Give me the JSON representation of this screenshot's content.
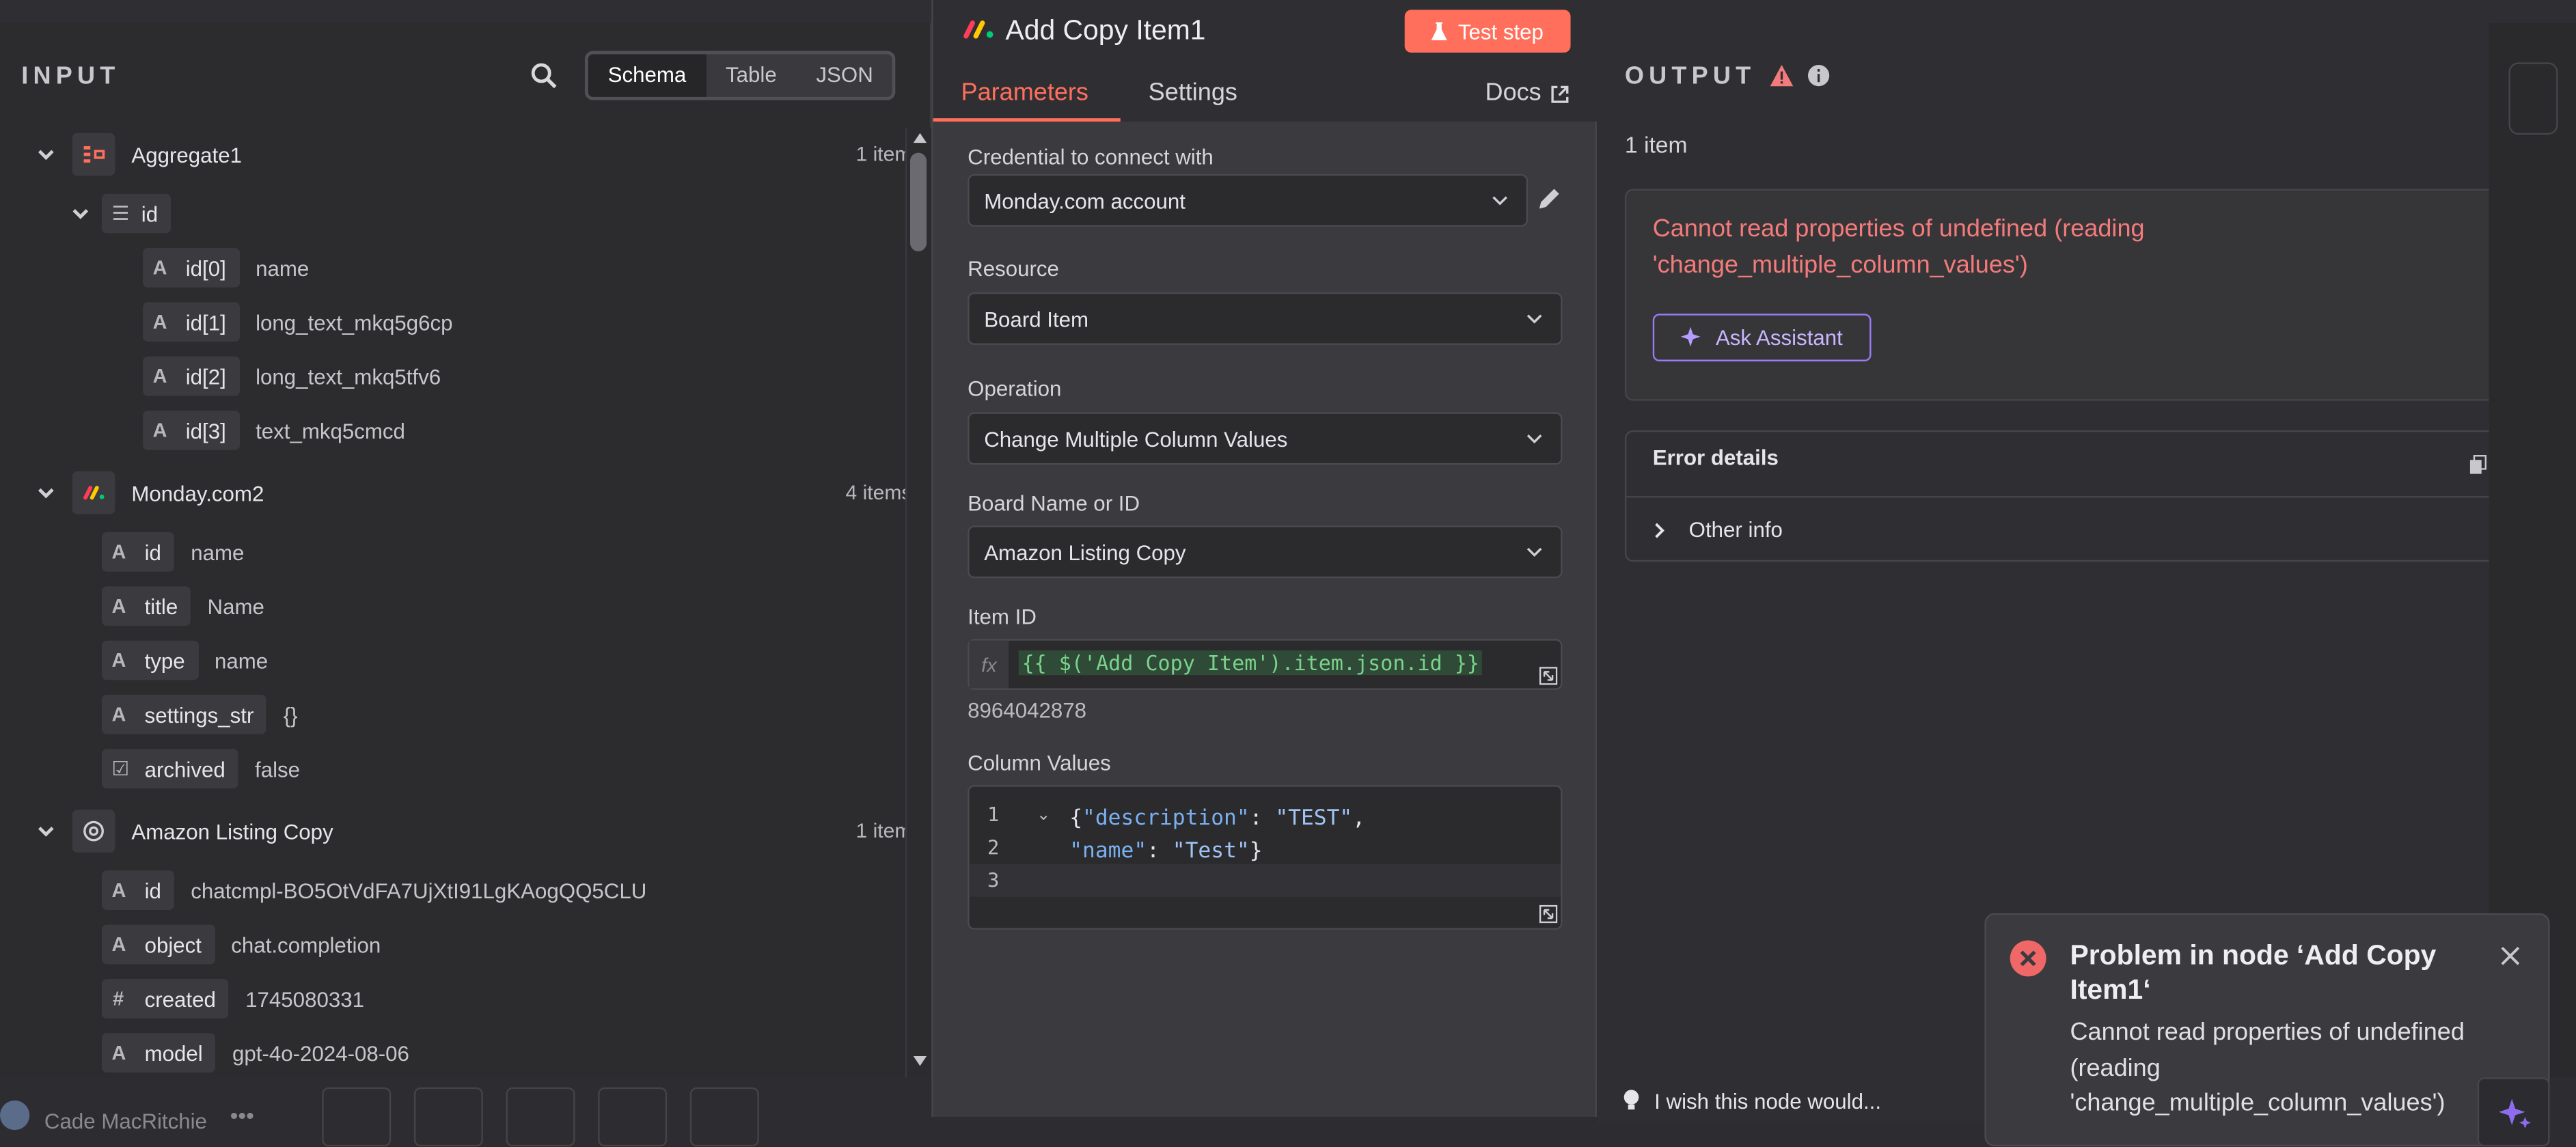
{
  "input": {
    "title": "INPUT",
    "views": [
      "Schema",
      "Table",
      "JSON"
    ],
    "nodes": [
      {
        "name": "Aggregate1",
        "count": "1 item"
      },
      {
        "name": "Monday.com2",
        "count": "4 items"
      },
      {
        "name": "Amazon Listing Copy",
        "count": "1 item"
      }
    ],
    "aggregate_group": "id",
    "aggregate_fields": [
      {
        "key": "id[0]",
        "value": "name"
      },
      {
        "key": "id[1]",
        "value": "long_text_mkq5g6cp"
      },
      {
        "key": "id[2]",
        "value": "long_text_mkq5tfv6"
      },
      {
        "key": "id[3]",
        "value": "text_mkq5cmcd"
      }
    ],
    "monday_fields": [
      {
        "type": "A",
        "key": "id",
        "value": "name"
      },
      {
        "type": "A",
        "key": "title",
        "value": "Name"
      },
      {
        "type": "A",
        "key": "type",
        "value": "name"
      },
      {
        "type": "A",
        "key": "settings_str",
        "value": "{}"
      },
      {
        "type": "☑",
        "key": "archived",
        "value": "false"
      }
    ],
    "amazon_fields": [
      {
        "type": "A",
        "key": "id",
        "value": "chatcmpl-BO5OtVdFA7UjXtI91LgKAogQQ5CLU"
      },
      {
        "type": "A",
        "key": "object",
        "value": "chat.completion"
      },
      {
        "type": "#",
        "key": "created",
        "value": "1745080331"
      },
      {
        "type": "A",
        "key": "model",
        "value": "gpt-4o-2024-08-06"
      }
    ]
  },
  "params": {
    "title": "Add Copy Item1",
    "test_step": "Test step",
    "tabs": [
      "Parameters",
      "Settings"
    ],
    "docs": "Docs",
    "credential_label": "Credential to connect with",
    "credential_value": "Monday.com account",
    "resource_label": "Resource",
    "resource_value": "Board Item",
    "operation_label": "Operation",
    "operation_value": "Change Multiple Column Values",
    "board_label": "Board Name or ID",
    "board_value": "Amazon Listing Copy",
    "item_id_label": "Item ID",
    "item_id_expr": "{{ $('Add Copy Item').item.json.id }}",
    "item_id_result": "8964042878",
    "column_values_label": "Column Values",
    "code_lines": [
      "1",
      "2",
      "3"
    ]
  },
  "output": {
    "title": "OUTPUT",
    "items": "1 item",
    "error_message": "Cannot read properties of undefined (reading 'change_multiple_column_values')",
    "ask_assistant": "Ask Assistant",
    "error_details": "Error details",
    "other_info": "Other info"
  },
  "toast": {
    "title": "Problem in node ‘Add Copy Item1‘",
    "message": "Cannot read properties of undefined (reading 'change_multiple_column_values')"
  },
  "footer": {
    "user": "Cade MacRitchie",
    "feedback": "I wish this node would..."
  },
  "colors": {
    "accent": "#ff6f5c",
    "error": "#f47b7b",
    "assistant": "#9b7bf7"
  }
}
